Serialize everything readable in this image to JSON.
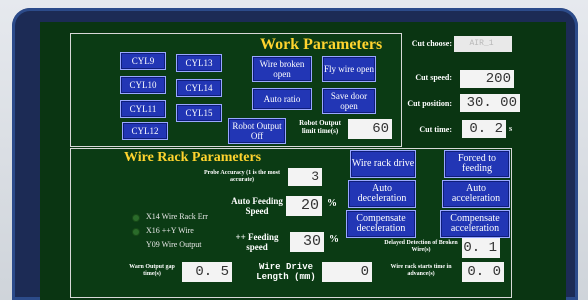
{
  "work_params": {
    "title": "Work Parameters",
    "cyl_buttons": [
      "CYL9",
      "CYL13",
      "CYL10",
      "CYL14",
      "CYL11",
      "CYL15",
      "CYL12"
    ],
    "wire_broken_open": "Wire broken open",
    "fly_wire_open": "Fly wire open",
    "auto_ratio": "Auto ratio",
    "save_door_open": "Save door open",
    "robot_output_off": "Robot Output Off",
    "robot_output_limit_label": "Robot Output limit time(s)",
    "robot_output_limit_value": "60",
    "cut_choose_label": "Cut choose:",
    "cut_choose_value": "AIR_1",
    "cut_speed_label": "Cut speed:",
    "cut_speed_value": "200",
    "cut_position_label": "Cut position:",
    "cut_position_value": "30. 00",
    "cut_time_label": "Cut time:",
    "cut_time_value": "0. 2",
    "cut_time_unit": "s"
  },
  "wire_rack": {
    "title": "Wire Rack Parameters",
    "probe_accuracy_label": "Probe Accuracy (1 is the most accurate)",
    "probe_accuracy_value": "3",
    "auto_feeding_speed_label": "Auto Feeding Speed",
    "auto_feeding_speed_value": "20",
    "feeding_speed_label": "++ Feeding speed",
    "feeding_speed_value": "30",
    "percent": "%",
    "status_x14": "X14 Wire Rack Err",
    "status_x16": "X16 ++Y Wire",
    "status_y09": "Y09 Wire Output",
    "warn_output_gap_label": "Warn Output gap time(s)",
    "warn_output_gap_value": "0. 5",
    "wire_drive_length_label": "Wire Drive Length (mm)",
    "wire_drive_length_value": "0",
    "wire_rack_drive": "Wire rack drive",
    "forced_to_feeding": "Forced to feeding",
    "auto_deceleration": "Auto deceleration",
    "auto_acceleration": "Auto acceleration",
    "compensate_deceleration": "Compensate deceleration",
    "compensate_acceleration": "Compensate acceleration",
    "delayed_detection_label": "Delayed Detection of Broken Wire(s)",
    "delayed_detection_value": "0. 1",
    "wire_rack_starts_label": "Wire rack starts time in advance(s)",
    "wire_rack_starts_value": "0. 0"
  },
  "colors": {
    "panel": "#0b3b14",
    "button": "#2236b5",
    "title": "#ffd42e"
  }
}
